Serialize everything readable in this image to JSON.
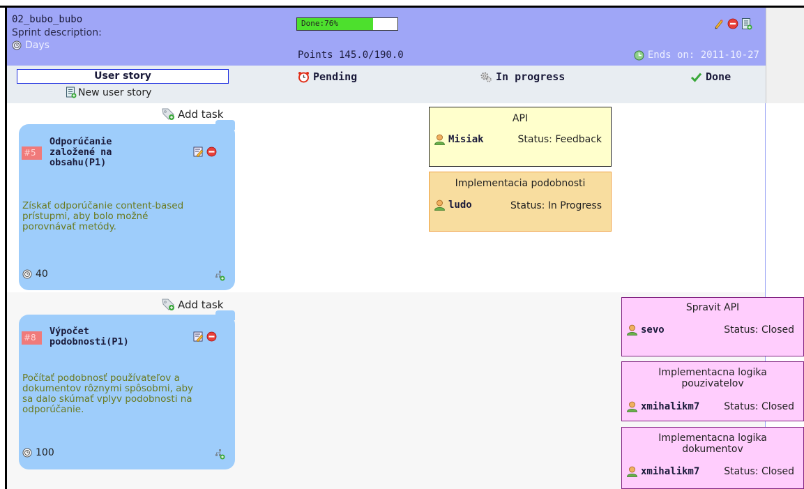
{
  "sprint": {
    "name": "02_bubo_bubo",
    "description_label": "Sprint description:",
    "days_label": "Days",
    "progress_label": "Done:76%",
    "progress_fraction": 0.76,
    "points": "Points 145.0/190.0",
    "ends_on": "Ends on: 2011-10-27"
  },
  "columns": {
    "user_story": "User story",
    "new_story": "New user story",
    "pending": "Pending",
    "in_progress": "In progress",
    "done": "Done"
  },
  "stories": [
    {
      "id": "#5",
      "title_lines": [
        "Odporúčanie",
        "založené na",
        "obsahu(P1)"
      ],
      "description_lines": [
        "Získať odporúčanie content-based",
        "prístupmi, aby bolo možné",
        "porovnávať metódy."
      ],
      "points": "40",
      "add_task": "Add task"
    },
    {
      "id": "#8",
      "title_lines": [
        "Výpočet",
        "podobnosti(P1)"
      ],
      "description_lines": [
        "Počítať podobnosť používateľov a",
        "dokumentov rôznymi spôsobmi, aby",
        "sa dalo skúmať vplyv podobnosti na",
        "odporúčanie."
      ],
      "points": "100",
      "add_task": "Add task"
    }
  ],
  "tasks": [
    {
      "title": "API",
      "user": "Misiak",
      "status": "Status: Feedback"
    },
    {
      "title": "Implementacia podobnosti",
      "user": "ludo",
      "status": "Status: In Progress"
    },
    {
      "title": "Spravit API",
      "user": "sevo",
      "status": "Status: Closed"
    },
    {
      "title_lines": [
        "Implementacna logika",
        "pouzivatelov"
      ],
      "user": "xmihalikm7",
      "status": "Status: Closed"
    },
    {
      "title_lines": [
        "Implementacna logika",
        "dokumentov"
      ],
      "user": "xmihalikm7",
      "status": "Status: Closed"
    }
  ],
  "colors": {
    "header_bg": "#9fa6f7",
    "story_card": "#9ecdfb",
    "task_feedback": "#ffffcc",
    "task_in_progress": "#f8dd9f",
    "task_closed": "#ffcdfd",
    "progress_fill": "#4de02d"
  },
  "icons": [
    "clock-icon",
    "pencil-icon",
    "delete-icon",
    "document-icon",
    "calendar-icon",
    "alarm-icon",
    "gear-icon",
    "checkmark-icon",
    "tag-icon",
    "edit-icon",
    "subtask-icon",
    "user-icon"
  ]
}
